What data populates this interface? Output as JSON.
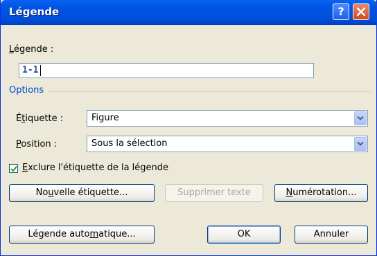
{
  "window": {
    "title": "Légende"
  },
  "caption": {
    "label_accel": "L",
    "label_rest": "égende :",
    "value": "1-1"
  },
  "options": {
    "group_label": "Options",
    "label": {
      "label_pre": "É",
      "label_accel": "t",
      "label_post": "iquette :",
      "value": "Figure"
    },
    "position": {
      "label_accel": "P",
      "label_rest": "osition :",
      "value": "Sous la sélection"
    }
  },
  "exclude": {
    "checked": true,
    "label_accel": "E",
    "label_rest": "xclure l'étiquette de la légende"
  },
  "buttons": {
    "new_label": {
      "pre": "No",
      "accel": "u",
      "post": "velle étiquette..."
    },
    "delete_label": "Supprimer texte",
    "numbering": {
      "accel": "N",
      "post": "umérotation..."
    },
    "auto_caption": {
      "pre": "Légende auto",
      "accel": "m",
      "post": "atique..."
    },
    "ok": "OK",
    "cancel": "Annuler"
  },
  "colors": {
    "title_bar": "#0054e3",
    "group_label": "#0046d5",
    "button_border": "#003c74"
  }
}
